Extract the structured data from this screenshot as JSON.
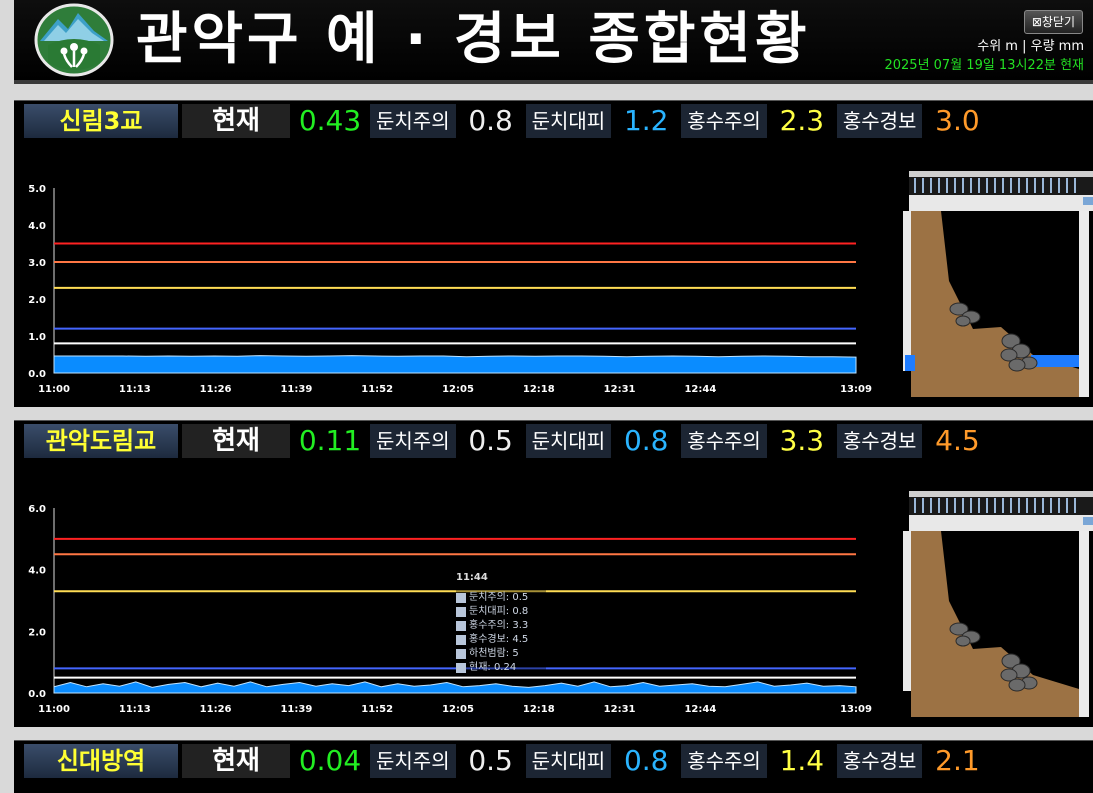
{
  "header": {
    "title": "관악구 예 · 경보 종합현황",
    "close_label": "⊠창닫기",
    "units": "수위 m | 우량 mm",
    "datetime": "2025년 07월 19일 13시22분 현재"
  },
  "colors": {
    "attention": "#eeeeee",
    "evacuation": "#2ab4ff",
    "flood_watch": "#ffff44",
    "flood_warning": "#ff9a2a",
    "current": "#22ee22",
    "water": "#0a8cff",
    "line_attention": "#ffffff",
    "line_evacuation": "#4466ff",
    "line_flood_watch": "#ffdd55",
    "line_flood_warning": "#ff7744",
    "line_overflow": "#ff2222"
  },
  "labels": {
    "current": "현재",
    "attention": "둔치주의",
    "evacuation": "둔치대피",
    "flood_watch": "홍수주의",
    "flood_warning": "홍수경보"
  },
  "stations": [
    {
      "name": "신림3교",
      "current": "0.43",
      "attention": "0.8",
      "evacuation": "1.2",
      "flood_watch": "2.3",
      "flood_warning": "3.0"
    },
    {
      "name": "관악도림교",
      "current": "0.11",
      "attention": "0.5",
      "evacuation": "0.8",
      "flood_watch": "3.3",
      "flood_warning": "4.5"
    },
    {
      "name": "신대방역",
      "current": "0.04",
      "attention": "0.5",
      "evacuation": "0.8",
      "flood_watch": "1.4",
      "flood_warning": "2.1"
    }
  ],
  "chart_data": [
    {
      "type": "area",
      "title": "",
      "x_ticks": [
        "11:00",
        "11:13",
        "11:26",
        "11:39",
        "11:52",
        "12:05",
        "12:18",
        "12:31",
        "12:44",
        "13:09"
      ],
      "y_ticks": [
        "0.0",
        "1.0",
        "2.0",
        "3.0",
        "4.0",
        "5.0"
      ],
      "ylim": [
        0,
        5
      ],
      "threshold_lines": [
        {
          "name": "둔치주의",
          "value": 0.8
        },
        {
          "name": "둔치대피",
          "value": 1.2
        },
        {
          "name": "홍수주의",
          "value": 2.3
        },
        {
          "name": "홍수경보",
          "value": 3.0
        },
        {
          "name": "하천범람",
          "value": 3.5
        }
      ],
      "series": [
        {
          "values": [
            0.46,
            0.46,
            0.46,
            0.46,
            0.45,
            0.46,
            0.45,
            0.46,
            0.45,
            0.47,
            0.46,
            0.45,
            0.46,
            0.47,
            0.46,
            0.45,
            0.46,
            0.46,
            0.44,
            0.45,
            0.46,
            0.45,
            0.46,
            0.46,
            0.45,
            0.44,
            0.45,
            0.46,
            0.45,
            0.44,
            0.45,
            0.46,
            0.45,
            0.44,
            0.44,
            0.43
          ]
        }
      ]
    },
    {
      "type": "area",
      "title": "",
      "x_ticks": [
        "11:00",
        "11:13",
        "11:26",
        "11:39",
        "11:52",
        "12:05",
        "12:18",
        "12:31",
        "12:44",
        "13:09"
      ],
      "y_ticks": [
        "0.0",
        "2.0",
        "4.0",
        "6.0"
      ],
      "ylim": [
        0,
        6
      ],
      "threshold_lines": [
        {
          "name": "둔치주의",
          "value": 0.5
        },
        {
          "name": "둔치대피",
          "value": 0.8
        },
        {
          "name": "홍수주의",
          "value": 3.3
        },
        {
          "name": "홍수경보",
          "value": 4.5
        },
        {
          "name": "하천범람",
          "value": 5
        }
      ],
      "series": [
        {
          "values": [
            0.2,
            0.34,
            0.2,
            0.3,
            0.22,
            0.36,
            0.18,
            0.28,
            0.34,
            0.2,
            0.32,
            0.22,
            0.36,
            0.2,
            0.28,
            0.34,
            0.22,
            0.3,
            0.24,
            0.36,
            0.2,
            0.3,
            0.22,
            0.26,
            0.34,
            0.2,
            0.24,
            0.3,
            0.22,
            0.18,
            0.24,
            0.32,
            0.22,
            0.36,
            0.2,
            0.24,
            0.34,
            0.22,
            0.26,
            0.3,
            0.22,
            0.2,
            0.28,
            0.36,
            0.22,
            0.26,
            0.32,
            0.22,
            0.24,
            0.2
          ]
        }
      ],
      "tooltip": {
        "time": "11:44",
        "rows": [
          "둔치주의: 0.5",
          "둔치대피: 0.8",
          "홍수주의: 3.3",
          "홍수경보: 4.5",
          "하천범람: 5",
          "현재: 0.24"
        ]
      }
    }
  ]
}
